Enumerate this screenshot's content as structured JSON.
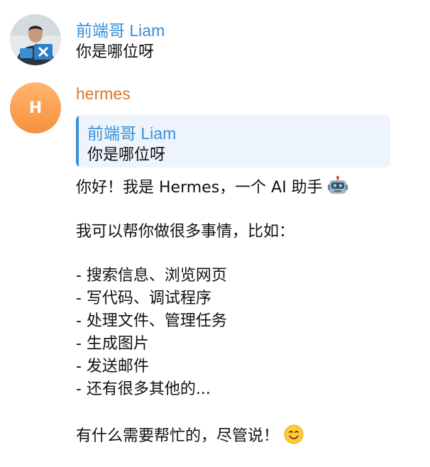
{
  "messages": [
    {
      "sender": "前端哥 Liam",
      "text": "你是哪位呀"
    },
    {
      "sender": "hermes",
      "avatar_letter": "H",
      "quote": {
        "author": "前端哥 Liam",
        "text": "你是哪位呀"
      },
      "lines": [
        "你好！我是 Hermes，一个 AI 助手",
        "我可以帮你做很多事情，比如：",
        "- 搜索信息、浏览网页",
        "- 写代码、调试程序",
        "- 处理文件、管理任务",
        "- 生成图片",
        "- 发送邮件",
        "- 还有很多其他的...",
        "有什么需要帮忙的，尽管说！"
      ]
    }
  ],
  "icons": {
    "robot": "robot-emoji",
    "smile": "smiling-face-emoji"
  },
  "colors": {
    "sender_blue": "#3a8fd6",
    "sender_orange": "#d9782f",
    "quote_bg": "#edf4fb",
    "avatar_orange": "#f7903f"
  }
}
